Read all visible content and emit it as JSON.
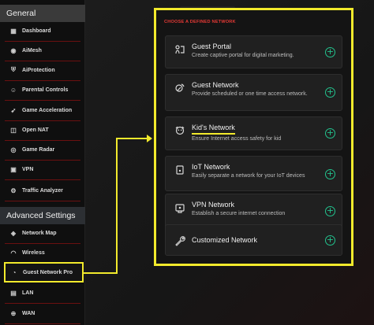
{
  "sidebar": {
    "general_label": "General",
    "advanced_label": "Advanced Settings",
    "general_items": [
      {
        "label": "Dashboard",
        "icon": "dashboard-icon"
      },
      {
        "label": "AiMesh",
        "icon": "aimesh-icon"
      },
      {
        "label": "AiProtection",
        "icon": "shield-icon"
      },
      {
        "label": "Parental Controls",
        "icon": "family-icon"
      },
      {
        "label": "Game Acceleration",
        "icon": "rocket-icon"
      },
      {
        "label": "Open NAT",
        "icon": "port-icon"
      },
      {
        "label": "Game Radar",
        "icon": "radar-icon"
      },
      {
        "label": "VPN",
        "icon": "vpn-icon"
      },
      {
        "label": "Traffic Analyzer",
        "icon": "traffic-icon"
      }
    ],
    "advanced_items": [
      {
        "label": "Network Map",
        "icon": "network-map-icon"
      },
      {
        "label": "Wireless",
        "icon": "wireless-icon"
      },
      {
        "label": "Guest Network Pro",
        "icon": "guest-network-icon",
        "active": true
      },
      {
        "label": "LAN",
        "icon": "lan-icon"
      },
      {
        "label": "WAN",
        "icon": "wan-icon"
      }
    ]
  },
  "panel": {
    "title": "CHOOSE A DEFINED NETWORK",
    "cards": [
      {
        "title": "Guest Portal",
        "desc": "Create captive portal for digital marketing.",
        "icon": "portal-icon"
      },
      {
        "title": "Guest Network",
        "desc": "Provide scheduled or one time access network.",
        "icon": "guest-icon"
      },
      {
        "title": "Kid's Network",
        "desc": "Ensure Internet access safety for kid",
        "icon": "kid-icon"
      },
      {
        "title": "IoT Network",
        "desc": "Easily separate a network for your IoT devices",
        "icon": "iot-icon"
      },
      {
        "title": "VPN Network",
        "desc": "Establish a secure internet connection",
        "icon": "vpn-network-icon"
      },
      {
        "title": "Customized Network",
        "desc": "",
        "icon": "wrench-icon"
      }
    ],
    "plus_symbol": "+"
  },
  "colors": {
    "highlight": "#f2ea2c",
    "accent_red": "#e53935",
    "plus_green": "#22c38e",
    "divider_red": "#6b1010"
  }
}
